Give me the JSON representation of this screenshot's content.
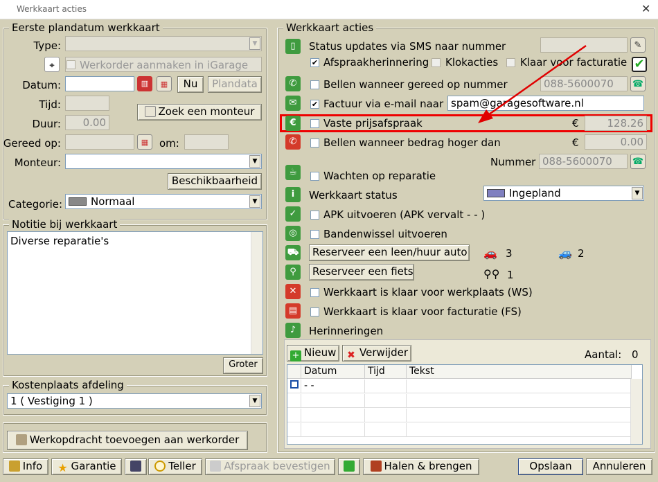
{
  "window": {
    "title": "Werkkaart acties",
    "close": "✕"
  },
  "left": {
    "plan_group": "Eerste plandatum werkkaart",
    "type_label": "Type:",
    "type_value": "",
    "werkorder_label": "Werkorder aanmaken in iGarage",
    "datum_label": "Datum:",
    "datum_value": "",
    "nu_button": "Nu",
    "plandata_button": "Plandata",
    "tijd_label": "Tijd:",
    "tijd_value": "",
    "duur_label": "Duur:",
    "duur_value": "0.00",
    "zoek_button": "Zoek een monteur",
    "gereed_label": "Gereed op:",
    "gereed_value": "",
    "om_label": "om:",
    "om_value": "",
    "monteur_label": "Monteur:",
    "monteur_value": "",
    "beschikbaarheid_button": "Beschikbaarheid",
    "categorie_label": "Categorie:",
    "categorie_value": "Normaal",
    "notitie_group": "Notitie bij werkkaart",
    "notitie_text": "Diverse reparatie's",
    "groter_button": "Groter",
    "kosten_group": "Kostenplaats afdeling",
    "kosten_value": "1 ( Vestiging 1 )",
    "werkopdracht_button": "Werkopdracht toevoegen aan werkorder"
  },
  "right": {
    "group": "Werkkaart acties",
    "sms_label": "Status updates via SMS naar nummer",
    "sms_value": "",
    "afspraak_label": "Afspraakherinnering",
    "klokacties_label": "Klokacties",
    "klaar_fact_label": "Klaar voor facturatie",
    "bellen_gereed_label": "Bellen wanneer gereed op nummer",
    "bellen_gereed_value": "088-5600070",
    "factuur_label": "Factuur via e-mail naar",
    "factuur_value": "spam@garagesoftware.nl",
    "vaste_label": "Vaste prijsafspraak",
    "euro": "€",
    "vaste_value": "128.26",
    "bellen_bedrag_label": "Bellen wanneer bedrag hoger dan",
    "bellen_bedrag_value": "0.00",
    "nummer_label": "Nummer",
    "nummer_value": "088-5600070",
    "wachten_label": "Wachten op reparatie",
    "status_label": "Werkkaart status",
    "status_value": "Ingepland",
    "apk_label": "APK uitvoeren (APK vervalt   -   -     )",
    "banden_label": "Bandenwissel uitvoeren",
    "leen_button": "Reserveer een leen/huur auto",
    "car_orange_count": "3",
    "car_green_count": "2",
    "fiets_button": "Reserveer een fiets",
    "bike_count": "1",
    "ws_label": "Werkkaart is klaar voor werkplaats (WS)",
    "fs_label": "Werkkaart is klaar voor facturatie (FS)",
    "herinneringen_label": "Herinneringen",
    "nieuw_button": "Nieuw",
    "verwijder_button": "Verwijder",
    "aantal_label": "Aantal:",
    "aantal_value": "0",
    "grid_headers": [
      "Datum",
      "Tijd",
      "Tekst"
    ],
    "grid_first_datum": " -  -"
  },
  "bottom": {
    "info": "Info",
    "garantie": "Garantie",
    "teller": "Teller",
    "afspraak": "Afspraak bevestigen",
    "halen": "Halen & brengen",
    "opslaan": "Opslaan",
    "annuleren": "Annuleren"
  },
  "colors": {
    "accent_red": "#e00000",
    "icon_green": "#3f9b3f",
    "icon_red": "#d43a2a"
  }
}
